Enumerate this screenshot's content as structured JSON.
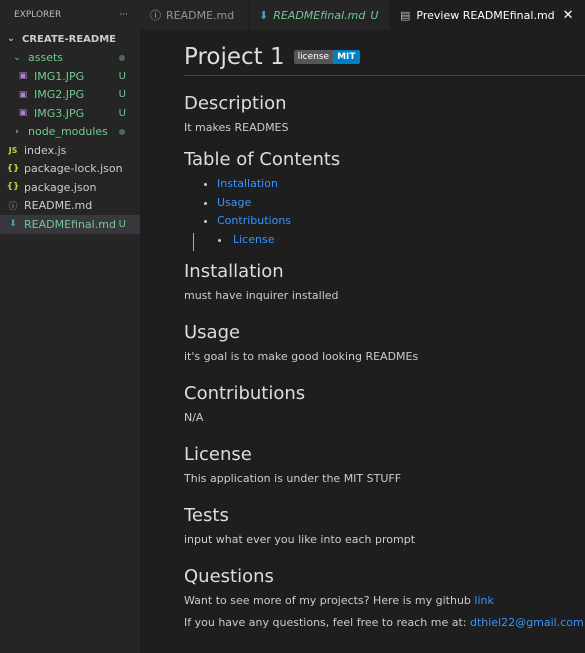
{
  "explorer": {
    "title": "EXPLORER",
    "more": "···",
    "root": "CREATE-README",
    "items": [
      {
        "label": "assets",
        "kind": "folder",
        "badge": ""
      },
      {
        "label": "IMG1.JPG",
        "kind": "img",
        "badge": "U"
      },
      {
        "label": "IMG2.JPG",
        "kind": "img",
        "badge": "U"
      },
      {
        "label": "IMG3.JPG",
        "kind": "img",
        "badge": "U"
      },
      {
        "label": "node_modules",
        "kind": "folder-closed",
        "badge": ""
      },
      {
        "label": "index.js",
        "kind": "js",
        "badge": ""
      },
      {
        "label": "package-lock.json",
        "kind": "json",
        "badge": ""
      },
      {
        "label": "package.json",
        "kind": "json",
        "badge": ""
      },
      {
        "label": "README.md",
        "kind": "info",
        "badge": ""
      },
      {
        "label": "READMEfinal.md",
        "kind": "md",
        "badge": "U"
      }
    ]
  },
  "tabs": [
    {
      "label": "README.md"
    },
    {
      "label": "READMEfinal.md",
      "badge": "U"
    },
    {
      "label": "Preview READMEfinal.md"
    }
  ],
  "doc": {
    "title": "Project 1",
    "badge_left": "license",
    "badge_right": "MIT",
    "description_h": "Description",
    "description": "It makes READMES",
    "toc_h": "Table of Contents",
    "toc": [
      "Installation",
      "Usage",
      "Contributions",
      "License"
    ],
    "installation_h": "Installation",
    "installation": "must have inquirer installed",
    "usage_h": "Usage",
    "usage": "it's goal is to make good looking READMEs",
    "contrib_h": "Contributions",
    "contrib": "N/A",
    "license_h": "License",
    "license": "This application is under the MIT STUFF",
    "tests_h": "Tests",
    "tests": "input what ever you like into each prompt",
    "questions_h": "Questions",
    "q1": "Want to see more of my projects? Here is my github ",
    "q1_link": "link",
    "q2": "If you have any questions, feel free to reach me at: ",
    "email": "dthiel22@gmail.com"
  }
}
